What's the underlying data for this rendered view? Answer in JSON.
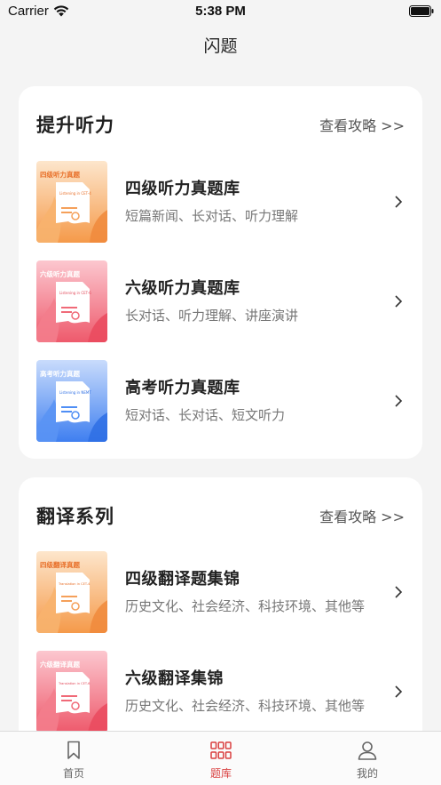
{
  "status_bar": {
    "carrier": "Carrier",
    "time": "5:38 PM"
  },
  "nav": {
    "title": "闪题"
  },
  "sections": [
    {
      "title": "提升听力",
      "link": "查看攻略 >>",
      "items": [
        {
          "title": "四级听力真题库",
          "subtitle": "短篇新闻、长对话、听力理解",
          "thumb_label": "四级听力真题",
          "thumb_text": "Listening in CET-4",
          "theme": "orange"
        },
        {
          "title": "六级听力真题库",
          "subtitle": "长对话、听力理解、讲座演讲",
          "thumb_label": "六级听力真题",
          "thumb_text": "Listening in CET-6",
          "theme": "red"
        },
        {
          "title": "高考听力真题库",
          "subtitle": "短对话、长对话、短文听力",
          "thumb_label": "高考听力真题",
          "thumb_text": "Listening in NEMT",
          "theme": "blue"
        }
      ]
    },
    {
      "title": "翻译系列",
      "link": "查看攻略 >>",
      "items": [
        {
          "title": "四级翻译题集锦",
          "subtitle": "历史文化、社会经济、科技环境、其他等",
          "thumb_label": "四级翻译真题",
          "thumb_text": "Translation in CET-4",
          "theme": "orange"
        },
        {
          "title": "六级翻译集锦",
          "subtitle": "历史文化、社会经济、科技环境、其他等",
          "thumb_label": "六级翻译真题",
          "thumb_text": "Translation in CET-6",
          "theme": "red"
        }
      ]
    }
  ],
  "tab_bar": {
    "tabs": [
      {
        "label": "首页",
        "icon": "bookmark-icon",
        "active": false
      },
      {
        "label": "题库",
        "icon": "grid-icon",
        "active": true
      },
      {
        "label": "我的",
        "icon": "person-icon",
        "active": false
      }
    ]
  },
  "colors": {
    "accent": "#d94040",
    "orange": "#f5a05a",
    "red": "#f06a78",
    "blue": "#4f8ef5"
  }
}
